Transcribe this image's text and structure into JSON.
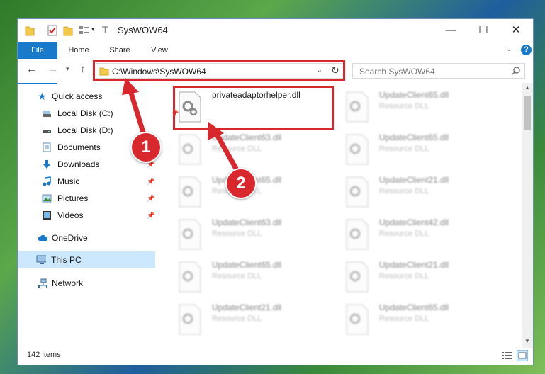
{
  "window": {
    "title": "SysWOW64",
    "controls": {
      "minimize": "—",
      "maximize": "☐",
      "close": "✕"
    }
  },
  "ribbon": {
    "tabs": [
      {
        "label": "File"
      },
      {
        "label": "Home"
      },
      {
        "label": "Share"
      },
      {
        "label": "View"
      }
    ],
    "help": "?"
  },
  "address": {
    "path": "C:\\Windows\\SysWOW64",
    "search_placeholder": "Search SysWOW64"
  },
  "sidebar": {
    "quick_access": "Quick access",
    "items": [
      {
        "label": "Local Disk (C:)",
        "icon": "drive-icon"
      },
      {
        "label": "Local Disk (D:)",
        "icon": "drive-icon"
      },
      {
        "label": "Documents",
        "icon": "documents-icon"
      },
      {
        "label": "Downloads",
        "icon": "downloads-icon"
      },
      {
        "label": "Music",
        "icon": "music-icon"
      },
      {
        "label": "Pictures",
        "icon": "pictures-icon"
      },
      {
        "label": "Videos",
        "icon": "videos-icon"
      }
    ],
    "onedrive": "OneDrive",
    "this_pc": "This PC",
    "network": "Network"
  },
  "files": [
    {
      "name": "privateadaptorhelper.dll",
      "desc": ""
    },
    {
      "name": "UpdateClient65.dll",
      "desc": "Resource DLL"
    },
    {
      "name": "UpdateClient63.dll",
      "desc": "Resource DLL"
    },
    {
      "name": "UpdateClient65.dll",
      "desc": "Resource DLL"
    },
    {
      "name": "UpdateClient65.dll",
      "desc": "Resource DLL"
    },
    {
      "name": "UpdateClient21.dll",
      "desc": "Resource DLL"
    },
    {
      "name": "UpdateClient63.dll",
      "desc": "Resource DLL"
    },
    {
      "name": "UpdateClient42.dll",
      "desc": "Resource DLL"
    },
    {
      "name": "UpdateClient65.dll",
      "desc": "Resource DLL"
    },
    {
      "name": "UpdateClient21.dll",
      "desc": "Resource DLL"
    },
    {
      "name": "UpdateClient21.dll",
      "desc": "Resource DLL"
    },
    {
      "name": "UpdateClient65.dll",
      "desc": "Resource DLL"
    }
  ],
  "status": {
    "item_count": "142 items"
  },
  "annotations": {
    "step1": "1",
    "step2": "2"
  },
  "colors": {
    "accent": "#1979ca",
    "annotation": "#d9272e",
    "selection": "#cce8ff"
  }
}
